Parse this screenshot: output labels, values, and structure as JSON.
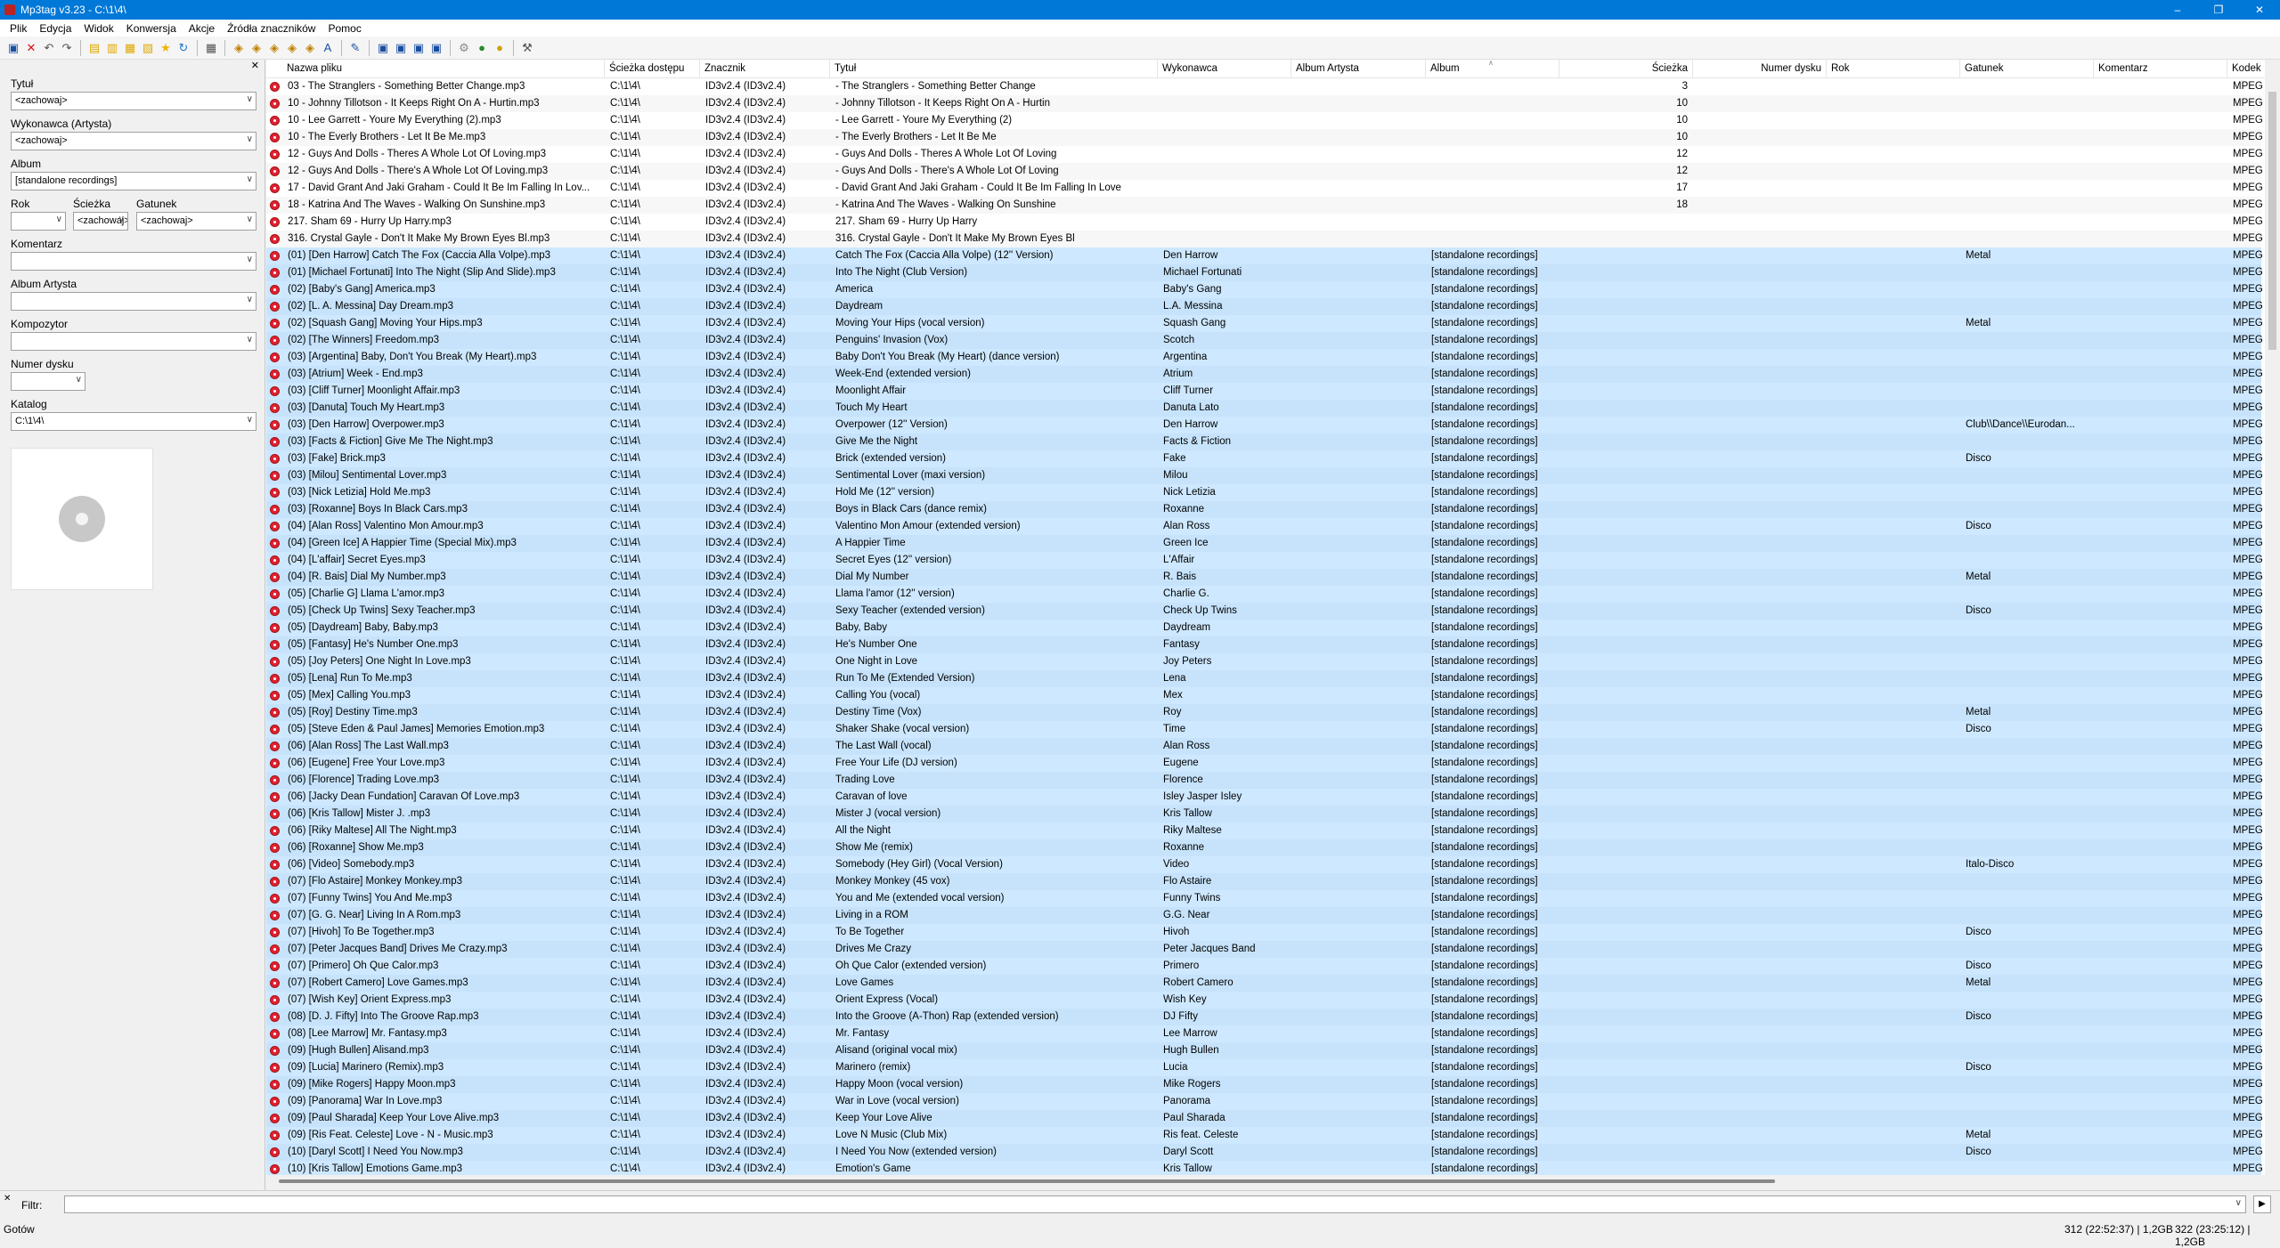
{
  "window": {
    "title": "Mp3tag v3.23  -  C:\\1\\4\\"
  },
  "menu": [
    "Plik",
    "Edycja",
    "Widok",
    "Konwersja",
    "Akcje",
    "Źródła znaczników",
    "Pomoc"
  ],
  "toolbar_icons": [
    "save-icon",
    "delete-icon",
    "undo-icon",
    "redo-icon",
    "rename-icon",
    "add-folder-icon",
    "open-folder-icon",
    "playlist-icon",
    "export-icon",
    "favorite-icon",
    "refresh-icon",
    "select-all-icon",
    "tag-file-icon",
    "file-tag-icon",
    "text-tag-icon",
    "tag-tag-icon",
    "autonumber-icon",
    "case-icon",
    "edit-icon",
    "copy-tag-icon",
    "paste-tag-icon",
    "remove-tag-icon",
    "tag-sources-icon",
    "actions-icon",
    "discogs-icon",
    "settings-icon"
  ],
  "panel": {
    "title_label": "Tytuł",
    "title_value": "<zachowaj>",
    "artist_label": "Wykonawca (Artysta)",
    "artist_value": "<zachowaj>",
    "album_label": "Album",
    "album_value": "[standalone recordings]",
    "year_label": "Rok",
    "year_value": "",
    "track_label": "Ścieżka",
    "track_value": "<zachowaj>",
    "genre_label": "Gatunek",
    "genre_value": "<zachowaj>",
    "comment_label": "Komentarz",
    "comment_value": "",
    "album_artist_label": "Album Artysta",
    "album_artist_value": "",
    "composer_label": "Kompozytor",
    "composer_value": "",
    "disc_label": "Numer dysku",
    "disc_value": "",
    "directory_label": "Katalog",
    "directory_value": "C:\\1\\4\\"
  },
  "columns": [
    "Nazwa pliku",
    "Ścieżka dostępu",
    "Znacznik",
    "Tytuł",
    "Wykonawca",
    "Album Artysta",
    "Album",
    "Ścieżka",
    "Numer dysku",
    "Rok",
    "Gatunek",
    "Komentarz",
    "Kodek"
  ],
  "rows": [
    [
      "03 - The Stranglers - Something Better Change.mp3",
      "C:\\1\\4\\",
      "ID3v2.4 (ID3v2.4)",
      "- The Stranglers - Something Better Change",
      "",
      "",
      "",
      "3",
      "",
      "",
      "",
      "",
      "MPEG"
    ],
    [
      "10 - Johnny Tillotson - It Keeps Right On A - Hurtin.mp3",
      "C:\\1\\4\\",
      "ID3v2.4 (ID3v2.4)",
      "- Johnny Tillotson - It Keeps Right On A - Hurtin",
      "",
      "",
      "",
      "10",
      "",
      "",
      "",
      "",
      "MPEG"
    ],
    [
      "10 - Lee Garrett - Youre My Everything (2).mp3",
      "C:\\1\\4\\",
      "ID3v2.4 (ID3v2.4)",
      "- Lee Garrett - Youre My Everything (2)",
      "",
      "",
      "",
      "10",
      "",
      "",
      "",
      "",
      "MPEG"
    ],
    [
      "10 - The Everly Brothers - Let It Be Me.mp3",
      "C:\\1\\4\\",
      "ID3v2.4 (ID3v2.4)",
      "- The Everly Brothers - Let It Be Me",
      "",
      "",
      "",
      "10",
      "",
      "",
      "",
      "",
      "MPEG"
    ],
    [
      "12 - Guys And Dolls - Theres A Whole Lot Of Loving.mp3",
      "C:\\1\\4\\",
      "ID3v2.4 (ID3v2.4)",
      "- Guys And Dolls - Theres A Whole Lot Of Loving",
      "",
      "",
      "",
      "12",
      "",
      "",
      "",
      "",
      "MPEG"
    ],
    [
      "12 - Guys And Dolls - There's A Whole Lot Of Loving.mp3",
      "C:\\1\\4\\",
      "ID3v2.4 (ID3v2.4)",
      "- Guys And Dolls - There's A Whole Lot Of Loving",
      "",
      "",
      "",
      "12",
      "",
      "",
      "",
      "",
      "MPEG"
    ],
    [
      "17 - David Grant And Jaki Graham - Could It Be Im Falling In Lov...",
      "C:\\1\\4\\",
      "ID3v2.4 (ID3v2.4)",
      "- David Grant And Jaki Graham - Could It Be Im Falling In Love",
      "",
      "",
      "",
      "17",
      "",
      "",
      "",
      "",
      "MPEG"
    ],
    [
      "18 - Katrina And The Waves - Walking On Sunshine.mp3",
      "C:\\1\\4\\",
      "ID3v2.4 (ID3v2.4)",
      "- Katrina And The Waves - Walking On Sunshine",
      "",
      "",
      "",
      "18",
      "",
      "",
      "",
      "",
      "MPEG"
    ],
    [
      "217. Sham 69 - Hurry Up Harry.mp3",
      "C:\\1\\4\\",
      "ID3v2.4 (ID3v2.4)",
      "217. Sham 69 - Hurry Up Harry",
      "",
      "",
      "",
      "",
      "",
      "",
      "",
      "",
      "MPEG"
    ],
    [
      "316. Crystal Gayle - Don't It Make My Brown Eyes Bl.mp3",
      "C:\\1\\4\\",
      "ID3v2.4 (ID3v2.4)",
      "316. Crystal Gayle - Don't It Make My Brown Eyes Bl",
      "",
      "",
      "",
      "",
      "",
      "",
      "",
      "",
      "MPEG"
    ],
    [
      "(01) [Den Harrow] Catch The Fox (Caccia Alla Volpe).mp3",
      "C:\\1\\4\\",
      "ID3v2.4 (ID3v2.4)",
      "Catch The Fox (Caccia Alla Volpe) (12'' Version)",
      "Den Harrow",
      "",
      "[standalone recordings]",
      "",
      "",
      "",
      "Metal",
      "",
      "MPEG"
    ],
    [
      "(01) [Michael Fortunati] Into The Night (Slip And Slide).mp3",
      "C:\\1\\4\\",
      "ID3v2.4 (ID3v2.4)",
      "Into The Night (Club Version)",
      "Michael Fortunati",
      "",
      "[standalone recordings]",
      "",
      "",
      "",
      "",
      "",
      "MPEG"
    ],
    [
      "(02) [Baby's Gang] America.mp3",
      "C:\\1\\4\\",
      "ID3v2.4 (ID3v2.4)",
      "America",
      "Baby's Gang",
      "",
      "[standalone recordings]",
      "",
      "",
      "",
      "",
      "",
      "MPEG"
    ],
    [
      "(02) [L. A. Messina] Day Dream.mp3",
      "C:\\1\\4\\",
      "ID3v2.4 (ID3v2.4)",
      "Daydream",
      "L.A. Messina",
      "",
      "[standalone recordings]",
      "",
      "",
      "",
      "",
      "",
      "MPEG"
    ],
    [
      "(02) [Squash Gang] Moving Your Hips.mp3",
      "C:\\1\\4\\",
      "ID3v2.4 (ID3v2.4)",
      "Moving Your Hips (vocal version)",
      "Squash Gang",
      "",
      "[standalone recordings]",
      "",
      "",
      "",
      "Metal",
      "",
      "MPEG"
    ],
    [
      "(02) [The Winners] Freedom.mp3",
      "C:\\1\\4\\",
      "ID3v2.4 (ID3v2.4)",
      "Penguins' Invasion (Vox)",
      "Scotch",
      "",
      "[standalone recordings]",
      "",
      "",
      "",
      "",
      "",
      "MPEG"
    ],
    [
      "(03) [Argentina] Baby, Don't You Break (My Heart).mp3",
      "C:\\1\\4\\",
      "ID3v2.4 (ID3v2.4)",
      "Baby Don't You Break (My Heart) (dance version)",
      "Argentina",
      "",
      "[standalone recordings]",
      "",
      "",
      "",
      "",
      "",
      "MPEG"
    ],
    [
      "(03) [Atrium] Week - End.mp3",
      "C:\\1\\4\\",
      "ID3v2.4 (ID3v2.4)",
      "Week-End (extended version)",
      "Atrium",
      "",
      "[standalone recordings]",
      "",
      "",
      "",
      "",
      "",
      "MPEG"
    ],
    [
      "(03) [Cliff Turner] Moonlight Affair.mp3",
      "C:\\1\\4\\",
      "ID3v2.4 (ID3v2.4)",
      "Moonlight Affair",
      "Cliff Turner",
      "",
      "[standalone recordings]",
      "",
      "",
      "",
      "",
      "",
      "MPEG"
    ],
    [
      "(03) [Danuta] Touch My Heart.mp3",
      "C:\\1\\4\\",
      "ID3v2.4 (ID3v2.4)",
      "Touch My Heart",
      "Danuta Lato",
      "",
      "[standalone recordings]",
      "",
      "",
      "",
      "",
      "",
      "MPEG"
    ],
    [
      "(03) [Den Harrow] Overpower.mp3",
      "C:\\1\\4\\",
      "ID3v2.4 (ID3v2.4)",
      "Overpower (12'' Version)",
      "Den Harrow",
      "",
      "[standalone recordings]",
      "",
      "",
      "",
      "Club\\\\Dance\\\\Eurodan...",
      "",
      "MPEG"
    ],
    [
      "(03) [Facts & Fiction] Give Me The Night.mp3",
      "C:\\1\\4\\",
      "ID3v2.4 (ID3v2.4)",
      "Give Me the Night",
      "Facts & Fiction",
      "",
      "[standalone recordings]",
      "",
      "",
      "",
      "",
      "",
      "MPEG"
    ],
    [
      "(03) [Fake] Brick.mp3",
      "C:\\1\\4\\",
      "ID3v2.4 (ID3v2.4)",
      "Brick (extended version)",
      "Fake",
      "",
      "[standalone recordings]",
      "",
      "",
      "",
      "Disco",
      "",
      "MPEG"
    ],
    [
      "(03) [Milou] Sentimental Lover.mp3",
      "C:\\1\\4\\",
      "ID3v2.4 (ID3v2.4)",
      "Sentimental Lover (maxi version)",
      "Milou",
      "",
      "[standalone recordings]",
      "",
      "",
      "",
      "",
      "",
      "MPEG"
    ],
    [
      "(03) [Nick Letizia] Hold Me.mp3",
      "C:\\1\\4\\",
      "ID3v2.4 (ID3v2.4)",
      "Hold Me (12'' version)",
      "Nick Letizia",
      "",
      "[standalone recordings]",
      "",
      "",
      "",
      "",
      "",
      "MPEG"
    ],
    [
      "(03) [Roxanne] Boys In Black Cars.mp3",
      "C:\\1\\4\\",
      "ID3v2.4 (ID3v2.4)",
      "Boys in Black Cars (dance remix)",
      "Roxanne",
      "",
      "[standalone recordings]",
      "",
      "",
      "",
      "",
      "",
      "MPEG"
    ],
    [
      "(04) [Alan Ross] Valentino Mon Amour.mp3",
      "C:\\1\\4\\",
      "ID3v2.4 (ID3v2.4)",
      "Valentino Mon Amour (extended version)",
      "Alan Ross",
      "",
      "[standalone recordings]",
      "",
      "",
      "",
      "Disco",
      "",
      "MPEG"
    ],
    [
      "(04) [Green Ice] A Happier Time (Special Mix).mp3",
      "C:\\1\\4\\",
      "ID3v2.4 (ID3v2.4)",
      "A Happier Time",
      "Green Ice",
      "",
      "[standalone recordings]",
      "",
      "",
      "",
      "",
      "",
      "MPEG"
    ],
    [
      "(04) [L'affair] Secret Eyes.mp3",
      "C:\\1\\4\\",
      "ID3v2.4 (ID3v2.4)",
      "Secret Eyes (12'' version)",
      "L'Affair",
      "",
      "[standalone recordings]",
      "",
      "",
      "",
      "",
      "",
      "MPEG"
    ],
    [
      "(04) [R. Bais] Dial My Number.mp3",
      "C:\\1\\4\\",
      "ID3v2.4 (ID3v2.4)",
      "Dial My Number",
      "R. Bais",
      "",
      "[standalone recordings]",
      "",
      "",
      "",
      "Metal",
      "",
      "MPEG"
    ],
    [
      "(05) [Charlie G] Llama L'amor.mp3",
      "C:\\1\\4\\",
      "ID3v2.4 (ID3v2.4)",
      "Llama l'amor (12'' version)",
      "Charlie G.",
      "",
      "[standalone recordings]",
      "",
      "",
      "",
      "",
      "",
      "MPEG"
    ],
    [
      "(05) [Check Up Twins] Sexy Teacher.mp3",
      "C:\\1\\4\\",
      "ID3v2.4 (ID3v2.4)",
      "Sexy Teacher (extended version)",
      "Check Up Twins",
      "",
      "[standalone recordings]",
      "",
      "",
      "",
      "Disco",
      "",
      "MPEG"
    ],
    [
      "(05) [Daydream] Baby, Baby.mp3",
      "C:\\1\\4\\",
      "ID3v2.4 (ID3v2.4)",
      "Baby, Baby",
      "Daydream",
      "",
      "[standalone recordings]",
      "",
      "",
      "",
      "",
      "",
      "MPEG"
    ],
    [
      "(05) [Fantasy] He's Number One.mp3",
      "C:\\1\\4\\",
      "ID3v2.4 (ID3v2.4)",
      "He's Number One",
      "Fantasy",
      "",
      "[standalone recordings]",
      "",
      "",
      "",
      "",
      "",
      "MPEG"
    ],
    [
      "(05) [Joy Peters] One Night In Love.mp3",
      "C:\\1\\4\\",
      "ID3v2.4 (ID3v2.4)",
      "One Night in Love",
      "Joy Peters",
      "",
      "[standalone recordings]",
      "",
      "",
      "",
      "",
      "",
      "MPEG"
    ],
    [
      "(05) [Lena] Run To Me.mp3",
      "C:\\1\\4\\",
      "ID3v2.4 (ID3v2.4)",
      "Run To Me (Extended Version)",
      "Lena",
      "",
      "[standalone recordings]",
      "",
      "",
      "",
      "",
      "",
      "MPEG"
    ],
    [
      "(05) [Mex] Calling You.mp3",
      "C:\\1\\4\\",
      "ID3v2.4 (ID3v2.4)",
      "Calling You (vocal)",
      "Mex",
      "",
      "[standalone recordings]",
      "",
      "",
      "",
      "",
      "",
      "MPEG"
    ],
    [
      "(05) [Roy] Destiny Time.mp3",
      "C:\\1\\4\\",
      "ID3v2.4 (ID3v2.4)",
      "Destiny Time (Vox)",
      "Roy",
      "",
      "[standalone recordings]",
      "",
      "",
      "",
      "Metal",
      "",
      "MPEG"
    ],
    [
      "(05) [Steve Eden & Paul James] Memories Emotion.mp3",
      "C:\\1\\4\\",
      "ID3v2.4 (ID3v2.4)",
      "Shaker Shake (vocal version)",
      "Time",
      "",
      "[standalone recordings]",
      "",
      "",
      "",
      "Disco",
      "",
      "MPEG"
    ],
    [
      "(06) [Alan Ross] The Last Wall.mp3",
      "C:\\1\\4\\",
      "ID3v2.4 (ID3v2.4)",
      "The Last Wall (vocal)",
      "Alan Ross",
      "",
      "[standalone recordings]",
      "",
      "",
      "",
      "",
      "",
      "MPEG"
    ],
    [
      "(06) [Eugene] Free Your Love.mp3",
      "C:\\1\\4\\",
      "ID3v2.4 (ID3v2.4)",
      "Free Your Life (DJ version)",
      "Eugene",
      "",
      "[standalone recordings]",
      "",
      "",
      "",
      "",
      "",
      "MPEG"
    ],
    [
      "(06) [Florence] Trading Love.mp3",
      "C:\\1\\4\\",
      "ID3v2.4 (ID3v2.4)",
      "Trading Love",
      "Florence",
      "",
      "[standalone recordings]",
      "",
      "",
      "",
      "",
      "",
      "MPEG"
    ],
    [
      "(06) [Jacky Dean Fundation] Caravan Of Love.mp3",
      "C:\\1\\4\\",
      "ID3v2.4 (ID3v2.4)",
      "Caravan of love",
      "Isley Jasper Isley",
      "",
      "[standalone recordings]",
      "",
      "",
      "",
      "",
      "",
      "MPEG"
    ],
    [
      "(06) [Kris Tallow] Mister J. .mp3",
      "C:\\1\\4\\",
      "ID3v2.4 (ID3v2.4)",
      "Mister J (vocal version)",
      "Kris Tallow",
      "",
      "[standalone recordings]",
      "",
      "",
      "",
      "",
      "",
      "MPEG"
    ],
    [
      "(06) [Riky Maltese] All The Night.mp3",
      "C:\\1\\4\\",
      "ID3v2.4 (ID3v2.4)",
      "All the Night",
      "Riky Maltese",
      "",
      "[standalone recordings]",
      "",
      "",
      "",
      "",
      "",
      "MPEG"
    ],
    [
      "(06) [Roxanne] Show Me.mp3",
      "C:\\1\\4\\",
      "ID3v2.4 (ID3v2.4)",
      "Show Me (remix)",
      "Roxanne",
      "",
      "[standalone recordings]",
      "",
      "",
      "",
      "",
      "",
      "MPEG"
    ],
    [
      "(06) [Video] Somebody.mp3",
      "C:\\1\\4\\",
      "ID3v2.4 (ID3v2.4)",
      "Somebody (Hey Girl) (Vocal Version)",
      "Video",
      "",
      "[standalone recordings]",
      "",
      "",
      "",
      "Italo-Disco",
      "",
      "MPEG"
    ],
    [
      "(07) [Flo Astaire] Monkey Monkey.mp3",
      "C:\\1\\4\\",
      "ID3v2.4 (ID3v2.4)",
      "Monkey Monkey (45 vox)",
      "Flo Astaire",
      "",
      "[standalone recordings]",
      "",
      "",
      "",
      "",
      "",
      "MPEG"
    ],
    [
      "(07) [Funny Twins] You And Me.mp3",
      "C:\\1\\4\\",
      "ID3v2.4 (ID3v2.4)",
      "You and Me (extended vocal version)",
      "Funny Twins",
      "",
      "[standalone recordings]",
      "",
      "",
      "",
      "",
      "",
      "MPEG"
    ],
    [
      "(07) [G. G. Near] Living In A Rom.mp3",
      "C:\\1\\4\\",
      "ID3v2.4 (ID3v2.4)",
      "Living in a ROM",
      "G.G. Near",
      "",
      "[standalone recordings]",
      "",
      "",
      "",
      "",
      "",
      "MPEG"
    ],
    [
      "(07) [Hivoh] To Be Together.mp3",
      "C:\\1\\4\\",
      "ID3v2.4 (ID3v2.4)",
      "To Be Together",
      "Hivoh",
      "",
      "[standalone recordings]",
      "",
      "",
      "",
      "Disco",
      "",
      "MPEG"
    ],
    [
      "(07) [Peter Jacques Band] Drives Me Crazy.mp3",
      "C:\\1\\4\\",
      "ID3v2.4 (ID3v2.4)",
      "Drives Me Crazy",
      "Peter Jacques Band",
      "",
      "[standalone recordings]",
      "",
      "",
      "",
      "",
      "",
      "MPEG"
    ],
    [
      "(07) [Primero] Oh Que Calor.mp3",
      "C:\\1\\4\\",
      "ID3v2.4 (ID3v2.4)",
      "Oh Que Calor (extended version)",
      "Primero",
      "",
      "[standalone recordings]",
      "",
      "",
      "",
      "Disco",
      "",
      "MPEG"
    ],
    [
      "(07) [Robert Camero] Love Games.mp3",
      "C:\\1\\4\\",
      "ID3v2.4 (ID3v2.4)",
      "Love Games",
      "Robert Camero",
      "",
      "[standalone recordings]",
      "",
      "",
      "",
      "Metal",
      "",
      "MPEG"
    ],
    [
      "(07) [Wish Key] Orient Express.mp3",
      "C:\\1\\4\\",
      "ID3v2.4 (ID3v2.4)",
      "Orient Express (Vocal)",
      "Wish Key",
      "",
      "[standalone recordings]",
      "",
      "",
      "",
      "",
      "",
      "MPEG"
    ],
    [
      "(08) [D. J. Fifty] Into The Groove Rap.mp3",
      "C:\\1\\4\\",
      "ID3v2.4 (ID3v2.4)",
      "Into the Groove (A-Thon) Rap (extended version)",
      "DJ Fifty",
      "",
      "[standalone recordings]",
      "",
      "",
      "",
      "Disco",
      "",
      "MPEG"
    ],
    [
      "(08) [Lee Marrow] Mr. Fantasy.mp3",
      "C:\\1\\4\\",
      "ID3v2.4 (ID3v2.4)",
      "Mr. Fantasy",
      "Lee Marrow",
      "",
      "[standalone recordings]",
      "",
      "",
      "",
      "",
      "",
      "MPEG"
    ],
    [
      "(09) [Hugh Bullen] Alisand.mp3",
      "C:\\1\\4\\",
      "ID3v2.4 (ID3v2.4)",
      "Alisand (original vocal mix)",
      "Hugh Bullen",
      "",
      "[standalone recordings]",
      "",
      "",
      "",
      "",
      "",
      "MPEG"
    ],
    [
      "(09) [Lucia] Marinero (Remix).mp3",
      "C:\\1\\4\\",
      "ID3v2.4 (ID3v2.4)",
      "Marinero (remix)",
      "Lucia",
      "",
      "[standalone recordings]",
      "",
      "",
      "",
      "Disco",
      "",
      "MPEG"
    ],
    [
      "(09) [Mike Rogers] Happy Moon.mp3",
      "C:\\1\\4\\",
      "ID3v2.4 (ID3v2.4)",
      "Happy Moon (vocal version)",
      "Mike Rogers",
      "",
      "[standalone recordings]",
      "",
      "",
      "",
      "",
      "",
      "MPEG"
    ],
    [
      "(09) [Panorama] War In Love.mp3",
      "C:\\1\\4\\",
      "ID3v2.4 (ID3v2.4)",
      "War in Love (vocal version)",
      "Panorama",
      "",
      "[standalone recordings]",
      "",
      "",
      "",
      "",
      "",
      "MPEG"
    ],
    [
      "(09) [Paul Sharada] Keep Your Love Alive.mp3",
      "C:\\1\\4\\",
      "ID3v2.4 (ID3v2.4)",
      "Keep Your Love Alive",
      "Paul Sharada",
      "",
      "[standalone recordings]",
      "",
      "",
      "",
      "",
      "",
      "MPEG"
    ],
    [
      "(09) [Ris Feat. Celeste] Love - N - Music.mp3",
      "C:\\1\\4\\",
      "ID3v2.4 (ID3v2.4)",
      "Love N Music (Club Mix)",
      "Ris feat. Celeste",
      "",
      "[standalone recordings]",
      "",
      "",
      "",
      "Metal",
      "",
      "MPEG"
    ],
    [
      "(10) [Daryl Scott] I Need You Now.mp3",
      "C:\\1\\4\\",
      "ID3v2.4 (ID3v2.4)",
      "I Need You Now (extended version)",
      "Daryl Scott",
      "",
      "[standalone recordings]",
      "",
      "",
      "",
      "Disco",
      "",
      "MPEG"
    ],
    [
      "(10) [Kris Tallow] Emotions Game.mp3",
      "C:\\1\\4\\",
      "ID3v2.4 (ID3v2.4)",
      "Emotion's Game",
      "Kris Tallow",
      "",
      "[standalone recordings]",
      "",
      "",
      "",
      "",
      "",
      "MPEG"
    ]
  ],
  "filter": {
    "label": "Filtr:",
    "value": ""
  },
  "status": {
    "state": "Gotów",
    "selection": "312 (22:52:37) | 1,2GB",
    "total": "322 (23:25:12) | 1,2GB"
  }
}
